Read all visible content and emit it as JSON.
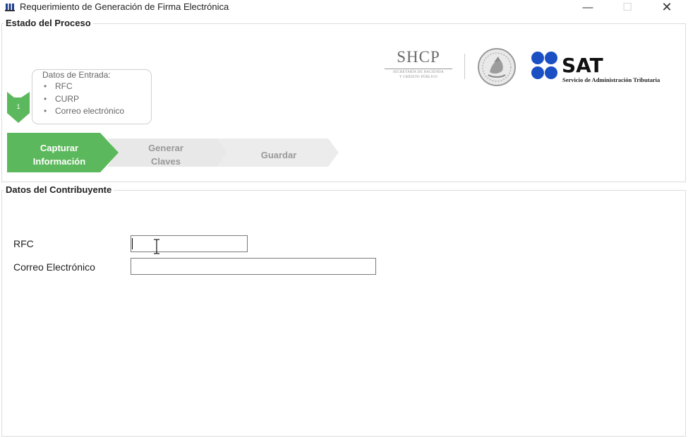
{
  "window": {
    "title": "Requerimiento de Generación de Firma Electrónica",
    "icons": {
      "app": "users-icon",
      "minimize": "minimize-icon",
      "maximize": "maximize-icon",
      "close": "close-icon"
    },
    "minimize_glyph": "—",
    "maximize_glyph": "☐",
    "close_glyph": "✕"
  },
  "estado_proceso": {
    "legend": "Estado del Proceso",
    "step_number": "1",
    "entry": {
      "title": "Datos de Entrada:",
      "items": [
        "RFC",
        "CURP",
        "Correo electrónico"
      ]
    },
    "steps": [
      {
        "line1": "Capturar",
        "line2": "Información",
        "state": "active"
      },
      {
        "line1": "Generar",
        "line2": "Claves",
        "state": "pending"
      },
      {
        "line1": "Guardar",
        "line2": "",
        "state": "pending"
      }
    ],
    "colors": {
      "active": "#5cb85c",
      "pending": "#ececec"
    }
  },
  "logos": {
    "shcp": {
      "title": "SHCP",
      "sub1": "SECRETARÍA DE HACIENDA",
      "sub2": "Y CRÉDITO PÚBLICO"
    },
    "seal_icon": "mexico-coat-of-arms-icon",
    "sat": {
      "title": "SAT",
      "subtitle": "Servicio de Administración Tributaria",
      "color": "#1b4fc4"
    }
  },
  "datos_contribuyente": {
    "legend": "Datos del Contribuyente",
    "rfc": {
      "label": "RFC",
      "value": ""
    },
    "email": {
      "label": "Correo Electrónico",
      "value": ""
    }
  }
}
